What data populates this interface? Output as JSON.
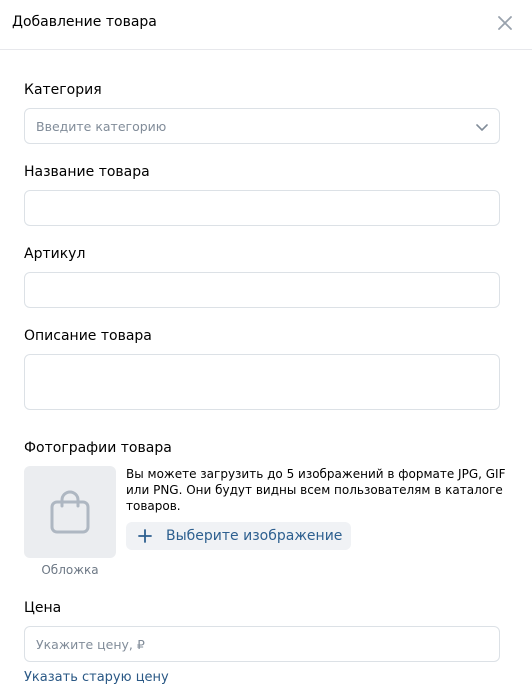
{
  "header": {
    "title": "Добавление товара"
  },
  "category": {
    "label": "Категория",
    "placeholder": "Введите категорию"
  },
  "name": {
    "label": "Название товара",
    "value": ""
  },
  "sku": {
    "label": "Артикул",
    "value": ""
  },
  "description": {
    "label": "Описание товара",
    "value": ""
  },
  "photos": {
    "label": "Фотографии товара",
    "description": "Вы можете загрузить до 5 изображений в формате JPG, GIF или PNG. Они будут видны всем пользователям в каталоге товаров.",
    "upload_label": "Выберите изображение",
    "cover_label": "Обложка",
    "placeholder_icon": "shopping-bag-icon"
  },
  "price": {
    "label": "Цена",
    "placeholder": "Укажите цену, ₽",
    "old_price_link": "Указать старую цену"
  },
  "colors": {
    "accent": "#2a5885",
    "border": "#dce1e6",
    "muted": "#818c99",
    "tile": "#ebedf0"
  }
}
